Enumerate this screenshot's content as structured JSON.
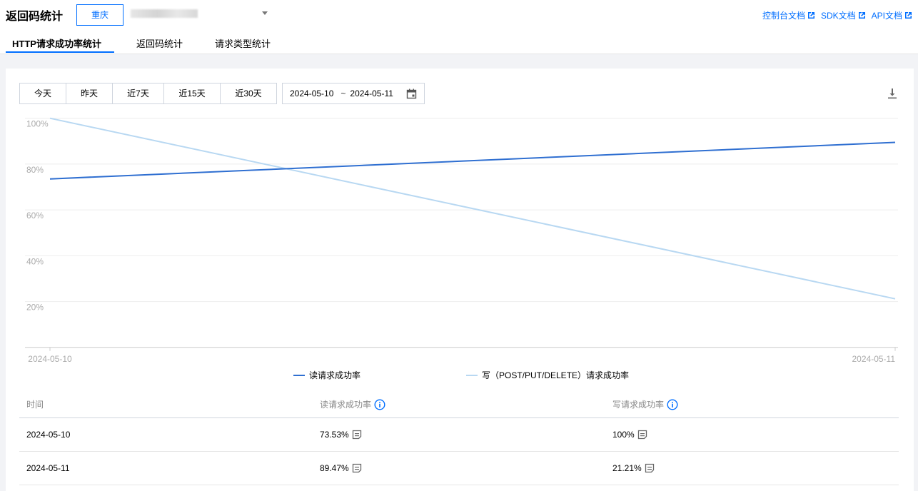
{
  "header": {
    "title": "返回码统计",
    "region_button": "重庆",
    "links": [
      {
        "label": "控制台文档",
        "icon": "external-link-icon"
      },
      {
        "label": "SDK文档",
        "icon": "external-link-icon"
      },
      {
        "label": "API文档",
        "icon": "external-link-icon"
      }
    ]
  },
  "tabs": [
    {
      "label": "HTTP请求成功率统计",
      "active": true
    },
    {
      "label": "返回码统计",
      "active": false
    },
    {
      "label": "请求类型统计",
      "active": false
    }
  ],
  "toolbar": {
    "ranges": [
      "今天",
      "昨天",
      "近7天",
      "近15天",
      "近30天"
    ],
    "date_start": "2024-05-10",
    "date_sep": "~",
    "date_end": "2024-05-11",
    "calendar_icon": "calendar-icon",
    "download_icon": "download-icon"
  },
  "colors": {
    "accent": "#006eff",
    "read_series": "#2f6fd1",
    "write_series": "#b8d8f2"
  },
  "chart_data": {
    "type": "line",
    "x": [
      "2024-05-10",
      "2024-05-11"
    ],
    "yticks": [
      "100%",
      "80%",
      "60%",
      "40%",
      "20%"
    ],
    "ylim": [
      0,
      100
    ],
    "grid": true,
    "legend_position": "bottom",
    "series": [
      {
        "name": "读请求成功率",
        "values": [
          73.53,
          89.47
        ]
      },
      {
        "name": "写（POST/PUT/DELETE）请求成功率",
        "values": [
          100,
          21.21
        ]
      }
    ]
  },
  "table": {
    "headers": [
      "时间",
      "读请求成功率",
      "写请求成功率"
    ],
    "rows": [
      {
        "time": "2024-05-10",
        "read": "73.53%",
        "write": "100%"
      },
      {
        "time": "2024-05-11",
        "read": "89.47%",
        "write": "21.21%"
      }
    ]
  }
}
